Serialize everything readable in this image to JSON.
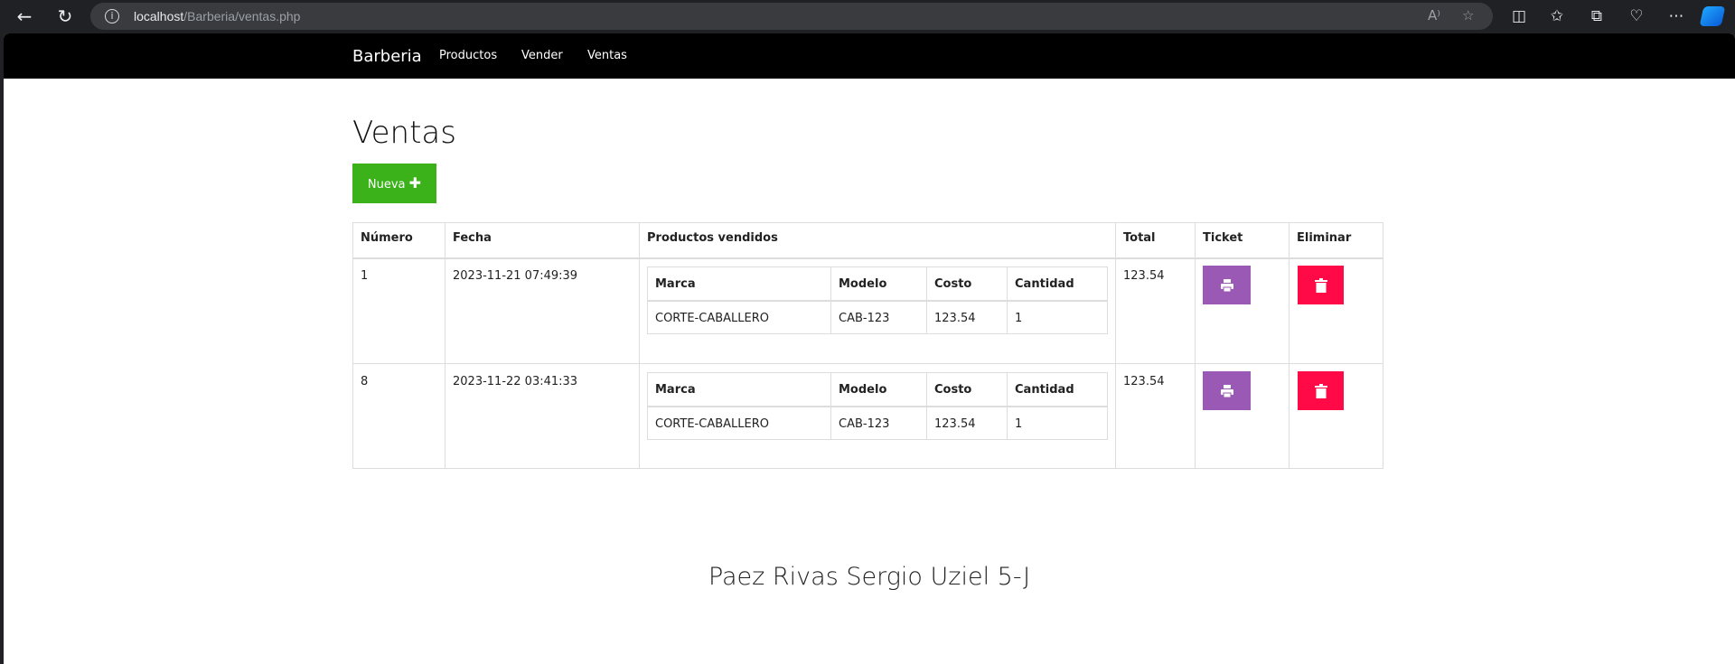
{
  "browser": {
    "url_host": "localhost",
    "url_path": "/Barberia/ventas.php",
    "icons": [
      "back-arrow-icon",
      "refresh-icon",
      "site-info-icon",
      "read-aloud-icon",
      "favorite-star-icon",
      "split-screen-icon",
      "favorites-icon",
      "collections-icon",
      "browser-essentials-icon",
      "more-menu-icon",
      "copilot-icon"
    ],
    "read_aloud_label": "A⁾",
    "more_label": "⋯"
  },
  "navbar": {
    "brand": "Barberia",
    "links": [
      "Productos",
      "Vender",
      "Ventas"
    ]
  },
  "page": {
    "title": "Ventas",
    "new_button": "Nueva",
    "new_button_icon": "plus-icon"
  },
  "table": {
    "headers": [
      "Número",
      "Fecha",
      "Productos vendidos",
      "Total",
      "Ticket",
      "Eliminar"
    ],
    "sub_headers": [
      "Marca",
      "Modelo",
      "Costo",
      "Cantidad"
    ],
    "rows": [
      {
        "numero": "1",
        "fecha": "2023-11-21 07:49:39",
        "productos": [
          {
            "marca": "CORTE-CABALLERO",
            "modelo": "CAB-123",
            "costo": "123.54",
            "cantidad": "1"
          }
        ],
        "total": "123.54"
      },
      {
        "numero": "8",
        "fecha": "2023-11-22 03:41:33",
        "productos": [
          {
            "marca": "CORTE-CABALLERO",
            "modelo": "CAB-123",
            "costo": "123.54",
            "cantidad": "1"
          }
        ],
        "total": "123.54"
      }
    ],
    "ticket_icon": "print-icon",
    "delete_icon": "trash-icon",
    "ticket_color": "#9b59b6",
    "delete_color": "#ff0a46"
  },
  "footer": {
    "name": "Paez Rivas Sergio Uziel 5-J"
  },
  "colors": {
    "navbar_bg": "#000000",
    "new_button_bg": "#3bb21a"
  }
}
